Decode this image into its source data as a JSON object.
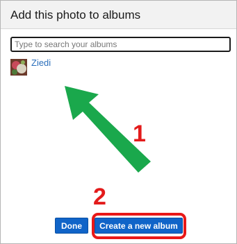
{
  "dialog": {
    "title": "Add this photo to albums",
    "search": {
      "placeholder": "Type to search your albums",
      "value": ""
    },
    "albums": [
      {
        "label": "Ziedi"
      }
    ],
    "buttons": {
      "done_label": "Done",
      "create_label": "Create a new album"
    }
  },
  "annotations": {
    "step1": "1",
    "step2": "2",
    "arrow_color": "#1aa84c",
    "highlight_color": "#e81818"
  },
  "colors": {
    "primary_button": "#1064c8",
    "link": "#2a6ebb"
  }
}
